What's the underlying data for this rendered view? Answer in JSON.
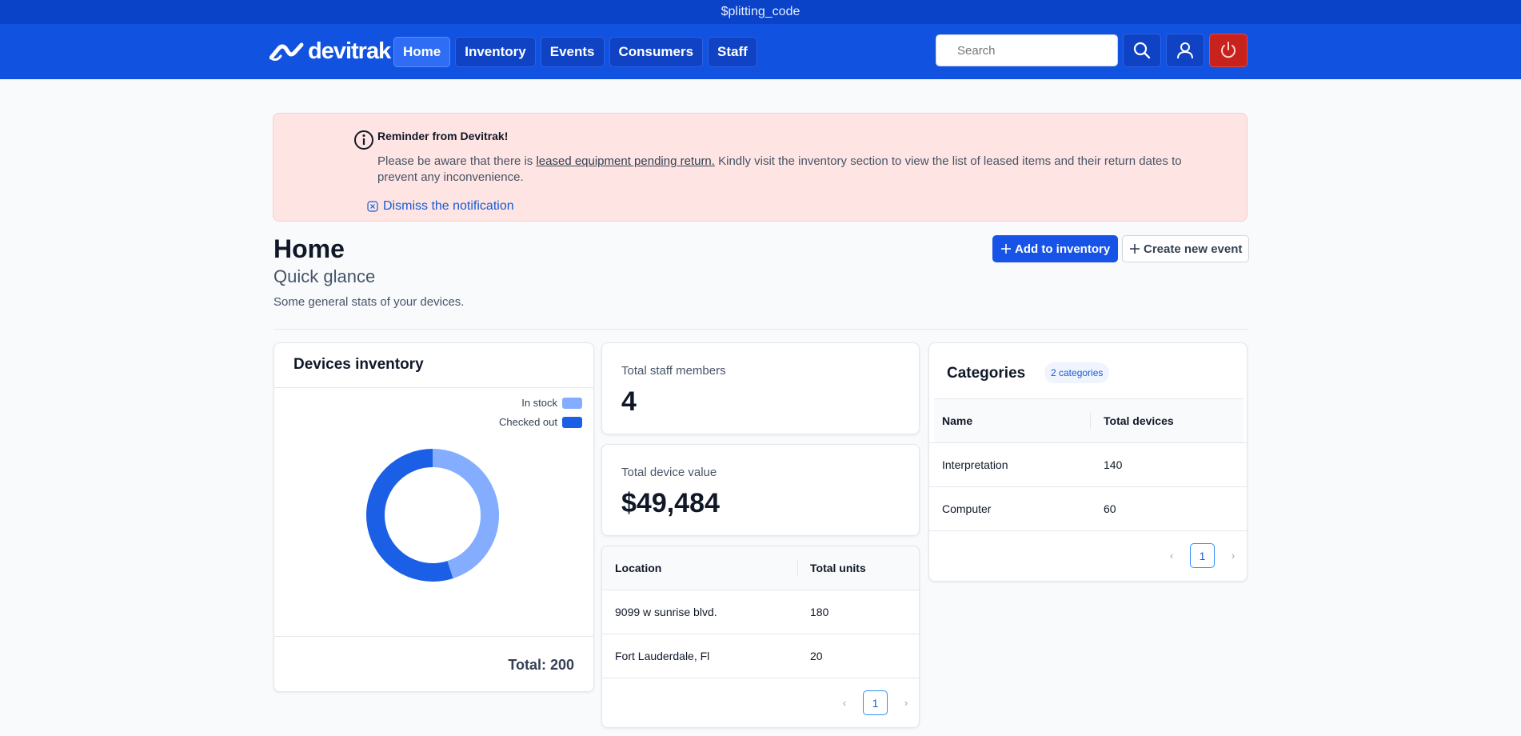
{
  "window": {
    "title": "$plitting_code"
  },
  "header": {
    "logo_text": "devitrak",
    "nav": [
      {
        "label": "Home",
        "active": true
      },
      {
        "label": "Inventory",
        "active": false
      },
      {
        "label": "Events",
        "active": false
      },
      {
        "label": "Consumers",
        "active": false
      },
      {
        "label": "Staff",
        "active": false
      }
    ],
    "search_placeholder": "Search",
    "icons": [
      "search-icon",
      "user-icon",
      "power-icon"
    ]
  },
  "notification": {
    "title": "Reminder from Devitrak!",
    "text_before": "Please be aware that there is ",
    "link_text": "leased equipment pending return.",
    "text_after": " Kindly visit the inventory section to view the list of leased items and their return dates to prevent any inconvenience.",
    "dismiss_label": "Dismiss the notification",
    "background": "#fee4e2"
  },
  "page": {
    "title": "Home",
    "subtitle": "Quick glance",
    "description": "Some general stats of your devices.",
    "add_button": "Add to inventory",
    "create_button": "Create new event"
  },
  "devices_inventory": {
    "title": "Devices inventory",
    "total_label": "Total: 200",
    "legend": [
      {
        "label": "In stock",
        "color": "#84adff"
      },
      {
        "label": "Checked out",
        "color": "#1b5fe6"
      }
    ]
  },
  "chart_data": {
    "type": "pie",
    "donut": true,
    "categories": [
      "In stock",
      "Checked out"
    ],
    "values": [
      45,
      55
    ],
    "colors": [
      "#84adff",
      "#1b5fe6"
    ],
    "legend_position": "top-right",
    "title": "Devices inventory"
  },
  "stats": {
    "staff": {
      "label": "Total staff members",
      "value": "4"
    },
    "device_value": {
      "label": "Total device value",
      "value": "$49,484"
    }
  },
  "locations_table": {
    "columns": [
      "Location",
      "Total units"
    ],
    "rows": [
      [
        "9099 w sunrise blvd.",
        "180"
      ],
      [
        "Fort Lauderdale, Fl",
        "20"
      ]
    ],
    "page": "1"
  },
  "categories": {
    "title": "Categories",
    "badge": "2 categories",
    "columns": [
      "Name",
      "Total devices"
    ],
    "rows": [
      [
        "Interpretation",
        "140"
      ],
      [
        "Computer",
        "60"
      ]
    ],
    "page": "1"
  },
  "colors": {
    "titlebar": "#0a42c8",
    "navbar": "#1252e0",
    "primary": "#1653e6",
    "logout": "#c8221d"
  }
}
